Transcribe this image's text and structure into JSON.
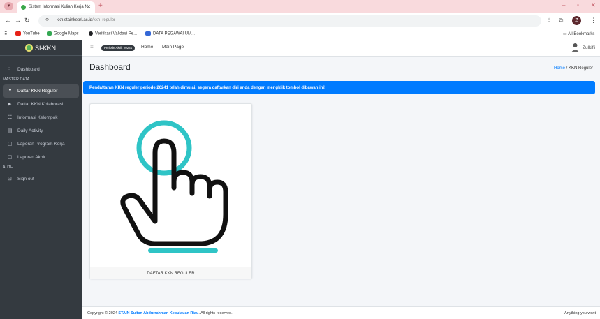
{
  "browser": {
    "tab_title": "Sistem Informasi Kuliah Kerja N",
    "url_host": "kkn.stainkepri.ac.id",
    "url_path": "/kkn_reguler",
    "bookmarks": [
      {
        "label": "YouTube",
        "color": "#e62117"
      },
      {
        "label": "Google Maps",
        "color": "#34a853"
      },
      {
        "label": "Verifikasi Validasi Pe...",
        "color": "#202124"
      },
      {
        "label": "DATA PEGAWAI UM...",
        "color": "#3367d6"
      }
    ],
    "all_bookmarks": "All Bookmarks"
  },
  "sidebar": {
    "brand": "SI-KKN",
    "items": [
      {
        "label": "Dashboard",
        "icon": "dashboard-icon",
        "glyph": "◌"
      },
      {
        "section": "MASTER DATA"
      },
      {
        "label": "Daftar KKN Reguler",
        "icon": "flag-icon",
        "glyph": "▼",
        "active": true
      },
      {
        "label": "Daftar KKN Kolaborasi",
        "icon": "flag-icon",
        "glyph": "▶"
      },
      {
        "label": "Informasi Kelompok",
        "icon": "group-icon",
        "glyph": "☷"
      },
      {
        "label": "Daily Activity",
        "icon": "calendar-icon",
        "glyph": "▤"
      },
      {
        "label": "Laporan Program Kerja",
        "icon": "document-icon",
        "glyph": "▢"
      },
      {
        "label": "Laporan Akhir",
        "icon": "document-icon",
        "glyph": "▢"
      },
      {
        "section": "AUTH"
      },
      {
        "label": "Sign out",
        "icon": "sign-out-icon",
        "glyph": "⊡"
      }
    ]
  },
  "topnav": {
    "period_badge": "Periode Aktif: 20241",
    "home": "Home",
    "main_page": "Main Page",
    "user": "Zulkifli"
  },
  "content": {
    "title": "Dashboard",
    "breadcrumb_home": "Home",
    "breadcrumb_sep": " / ",
    "breadcrumb_current": "KKN Reguler",
    "alert": "Pendaftaran KKN reguler periode 20241 telah dimulai, segera daftarkan diri anda dengan mengklik tombol dibawah ini!",
    "card_label": "DAFTAR KKN REGULER"
  },
  "footer": {
    "copyright_prefix": "Copyright © 2024",
    "institution": "STAIN Sultan Abdurrahman Kepulauan Riau",
    "copyright_suffix": ". All rights reserved.",
    "right_text": "Anything you want"
  },
  "colors": {
    "accent": "#007bff",
    "sidebar": "#343a40",
    "hand_ring": "#2fc4c6"
  }
}
